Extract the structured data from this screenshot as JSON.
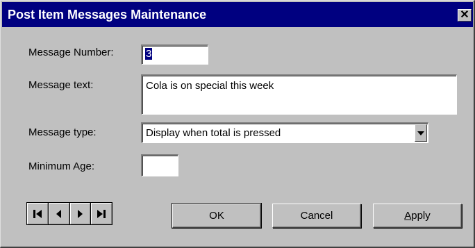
{
  "window": {
    "title": "Post Item Messages Maintenance",
    "close_glyph": "✕",
    "close_icon": "close-icon"
  },
  "form": {
    "number_label": "Message Number:",
    "number_value": "3",
    "text_label": "Message text:",
    "text_value": "Cola is on special this week",
    "type_label": "Message type:",
    "type_value": "Display when total is pressed",
    "type_dropdown_icon": "chevron-down-icon",
    "age_label": "Minimum Age:",
    "age_value": ""
  },
  "nav": {
    "icons": [
      "first-record-icon",
      "previous-record-icon",
      "next-record-icon",
      "last-record-icon"
    ]
  },
  "buttons": {
    "ok": "OK",
    "cancel": "Cancel",
    "apply_accel": "A",
    "apply_rest": "pply"
  },
  "colors": {
    "titlebar": "#000080",
    "face": "#c0c0c0",
    "selection": "#000080"
  }
}
